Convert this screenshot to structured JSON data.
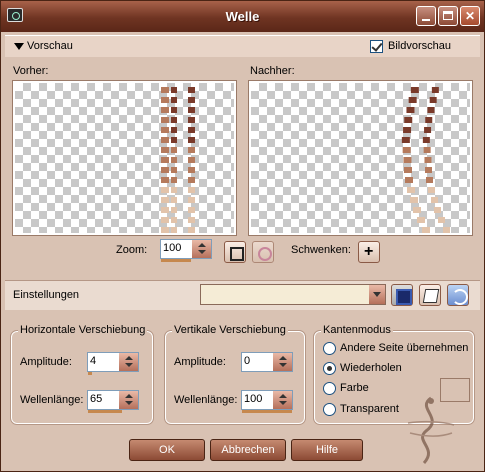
{
  "window": {
    "title": "Welle"
  },
  "preview_section": {
    "toggle_label": "Vorschau",
    "bildvorschau_label": "Bildvorschau",
    "bildvorschau_checked": true
  },
  "previews": {
    "before_label": "Vorher:",
    "after_label": "Nachher:"
  },
  "zoom": {
    "label": "Zoom:",
    "value": "100",
    "pan_label": "Schwenken:"
  },
  "settings": {
    "label": "Einstellungen",
    "preset_value": ""
  },
  "horizontal": {
    "title": "Horizontale Verschiebung",
    "amplitude_label": "Amplitude:",
    "amplitude_value": "4",
    "wavelength_label": "Wellenlänge:",
    "wavelength_value": "65"
  },
  "vertical": {
    "title": "Vertikale Verschiebung",
    "amplitude_label": "Amplitude:",
    "amplitude_value": "0",
    "wavelength_label": "Wellenlänge:",
    "wavelength_value": "100"
  },
  "edge_mode": {
    "title": "Kantenmodus",
    "options": [
      "Andere Seite übernehmen",
      "Wiederholen",
      "Farbe",
      "Transparent"
    ],
    "selected": "Wiederholen"
  },
  "buttons": {
    "ok": "OK",
    "cancel": "Abbrechen",
    "help": "Hilfe"
  },
  "colors": {
    "stripe_dark": "#7a3a2a",
    "stripe_mid": "#b57a5c",
    "stripe_light": "#e2c3aa",
    "accent": "#6f3422"
  },
  "icons": {
    "app": "psp-app-icon",
    "save": "save-disk-icon",
    "random": "dice-icon",
    "reset": "reset-icon",
    "pan": "move-cross-icon"
  }
}
